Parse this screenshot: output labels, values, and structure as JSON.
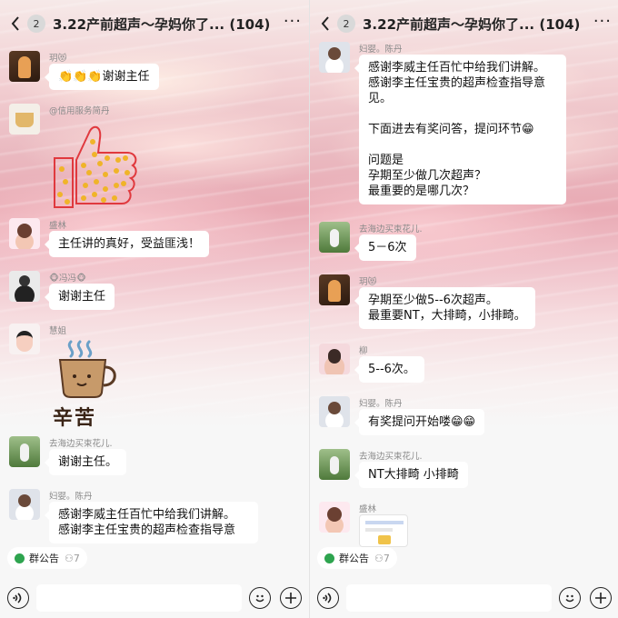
{
  "left": {
    "title": "3.22产前超声～孕妈你了...",
    "badge": "2",
    "count": "(104)",
    "messages": [
      {
        "name": "玥😻",
        "text": "👏👏👏谢谢主任"
      },
      {
        "name": "@信用服务简丹",
        "text": ""
      },
      {
        "name": "盛林",
        "text": "主任讲的真好，受益匪浅！"
      },
      {
        "name": "🐵冯冯🐵",
        "text": "谢谢主任"
      },
      {
        "name": "慧姐",
        "text": "",
        "sticker_text": "辛苦"
      },
      {
        "name": "去海边买束花儿.",
        "text": "谢谢主任。"
      },
      {
        "name": "妇婴。陈丹",
        "text": "感谢李威主任百忙中给我们讲解。\n感谢李主任宝贵的超声检查指导意"
      }
    ],
    "notice": {
      "label": "群公告",
      "count": "7"
    }
  },
  "right": {
    "title": "3.22产前超声～孕妈你了...",
    "badge": "2",
    "count": "(104)",
    "messages": [
      {
        "name": "妇婴。陈丹",
        "text": "感谢李威主任百忙中给我们讲解。\n感谢李主任宝贵的超声检查指导意见。\n\n下面进去有奖问答，提问环节😁\n\n问题是\n孕期至少做几次超声？\n最重要的是哪几次？"
      },
      {
        "name": "去海边买束花儿.",
        "text": "5－6次"
      },
      {
        "name": "玥😻",
        "text": "孕期至少做5--6次超声。\n最重要NT，大排畸，小排畸。"
      },
      {
        "name": "柳",
        "text": "5--6次。"
      },
      {
        "name": "妇婴。陈丹",
        "text": "有奖提问开始喽😁😁"
      },
      {
        "name": "去海边买束花儿.",
        "text": "NT大排畸 小排畸"
      },
      {
        "name": "盛林",
        "text": ""
      }
    ],
    "notice": {
      "label": "群公告",
      "count": "7"
    }
  },
  "colors": {
    "notice_dot": "#2ea44f",
    "bubble": "#ffffff",
    "thumb_outline": "#e0393e"
  },
  "icons": [
    "back-icon",
    "more-icon",
    "voice-icon",
    "emoji-icon",
    "plus-icon",
    "megaphone-icon",
    "members-icon"
  ]
}
